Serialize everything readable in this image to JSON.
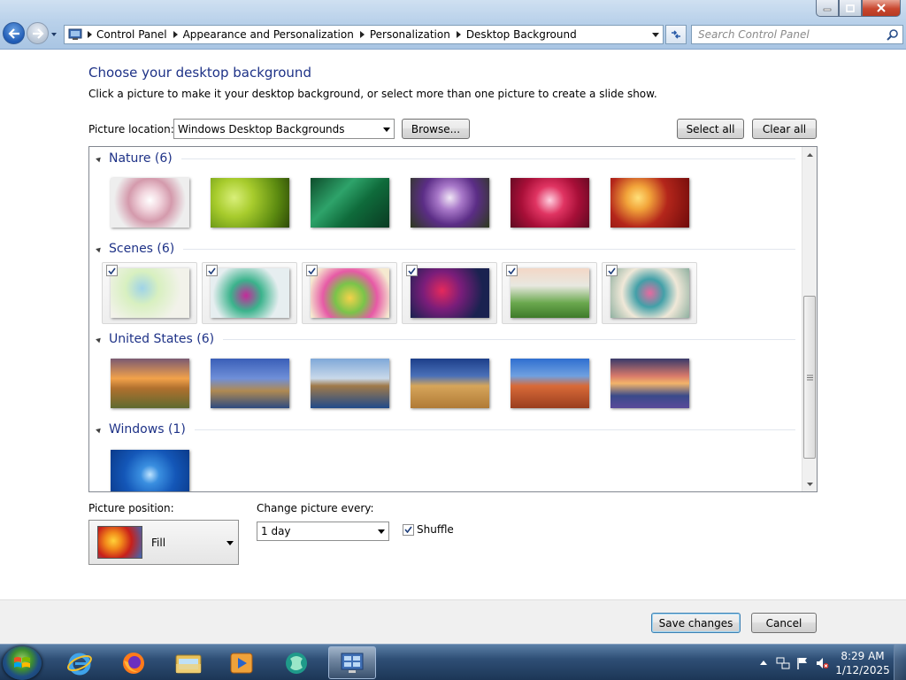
{
  "breadcrumb": [
    "Control Panel",
    "Appearance and Personalization",
    "Personalization",
    "Desktop Background"
  ],
  "search": {
    "placeholder": "Search Control Panel"
  },
  "page": {
    "title": "Choose your desktop background",
    "subtitle": "Click a picture to make it your desktop background, or select more than one picture to create a slide show."
  },
  "location": {
    "label": "Picture location:",
    "value": "Windows Desktop Backgrounds",
    "browse": "Browse...",
    "select_all": "Select all",
    "clear_all": "Clear all"
  },
  "groups": [
    {
      "title": "Nature (6)",
      "selected": false,
      "count": 6
    },
    {
      "title": "Scenes (6)",
      "selected": true,
      "count": 6
    },
    {
      "title": "United States (6)",
      "selected": false,
      "count": 6
    },
    {
      "title": "Windows (1)",
      "selected": false,
      "count": 1
    }
  ],
  "position": {
    "label": "Picture position:",
    "value": "Fill"
  },
  "interval": {
    "label": "Change picture every:",
    "value": "1 day"
  },
  "shuffle": {
    "label": "Shuffle",
    "checked": true
  },
  "footer": {
    "save": "Save changes",
    "cancel": "Cancel"
  },
  "clock": {
    "time": "8:29 AM",
    "date": "1/12/2025"
  },
  "colors": {
    "accent": "#1e3287",
    "title_blue": "#1e3287",
    "taskbar": "#2f4f76"
  }
}
